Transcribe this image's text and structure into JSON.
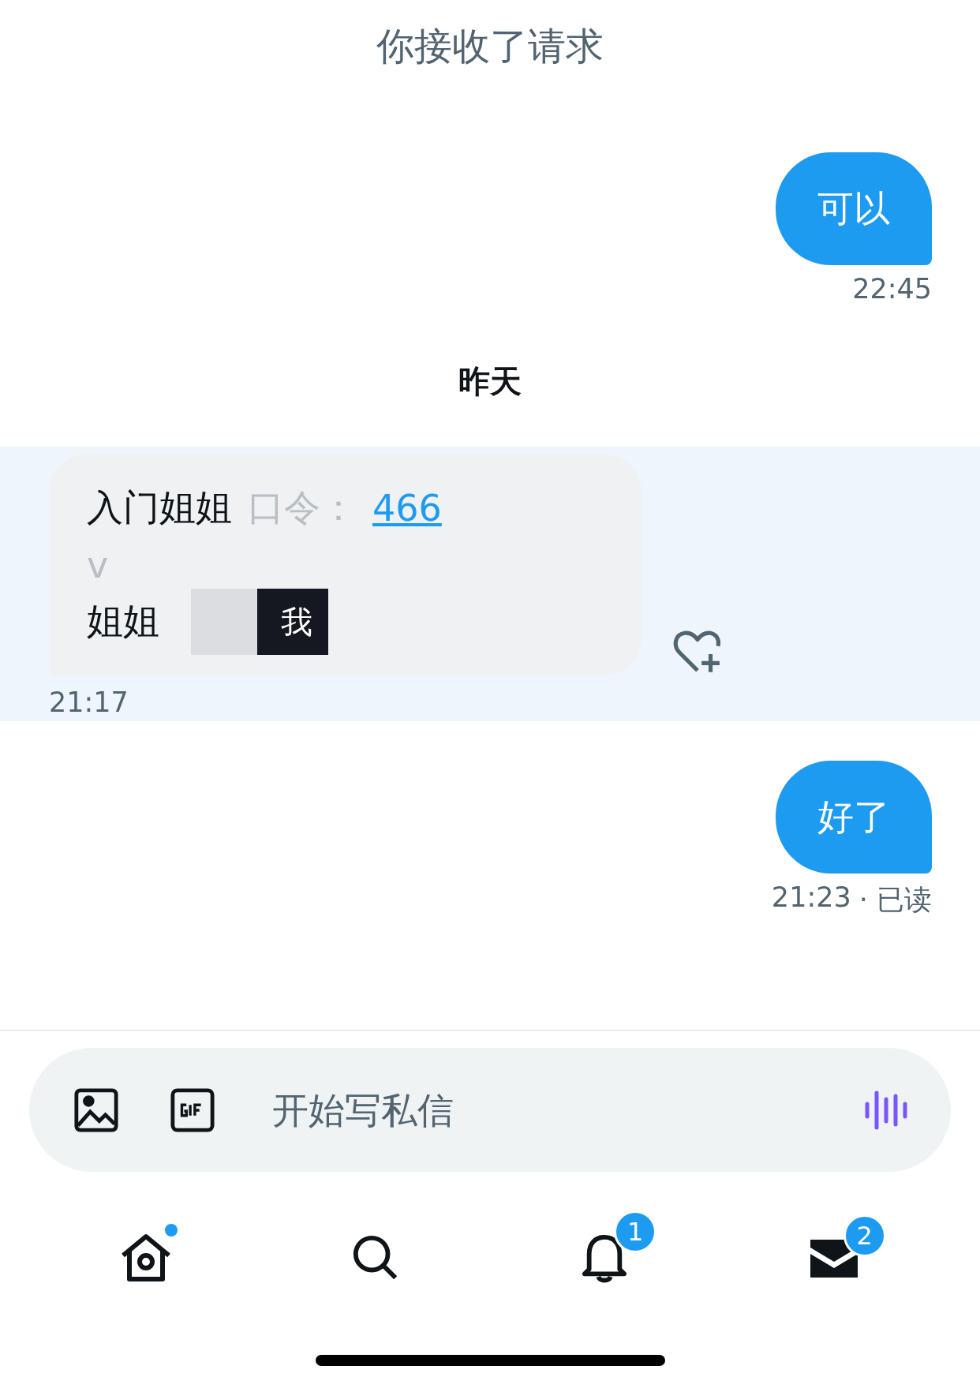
{
  "header": {
    "title": "你接收了请求"
  },
  "messages": [
    {
      "kind": "sent",
      "text": "可以",
      "time": "22:45"
    },
    {
      "kind": "date",
      "text": "昨天"
    },
    {
      "kind": "received",
      "line_1": "入门姐姐",
      "line_1_label": "口令：",
      "link": "466",
      "line_2": "v",
      "line_3_start": "姐姐",
      "line_3_end": "我",
      "time": "21:17",
      "highlighted": true
    },
    {
      "kind": "sent",
      "text": "好了",
      "time": "21:23",
      "status": "· 已读"
    }
  ],
  "composer": {
    "placeholder": "开始写私信"
  },
  "tab_bar": [
    {
      "kind": "home",
      "dot": true
    },
    {
      "kind": "search"
    },
    {
      "kind": "notifications",
      "badge": "1"
    },
    {
      "kind": "messages",
      "badge": "2"
    }
  ]
}
